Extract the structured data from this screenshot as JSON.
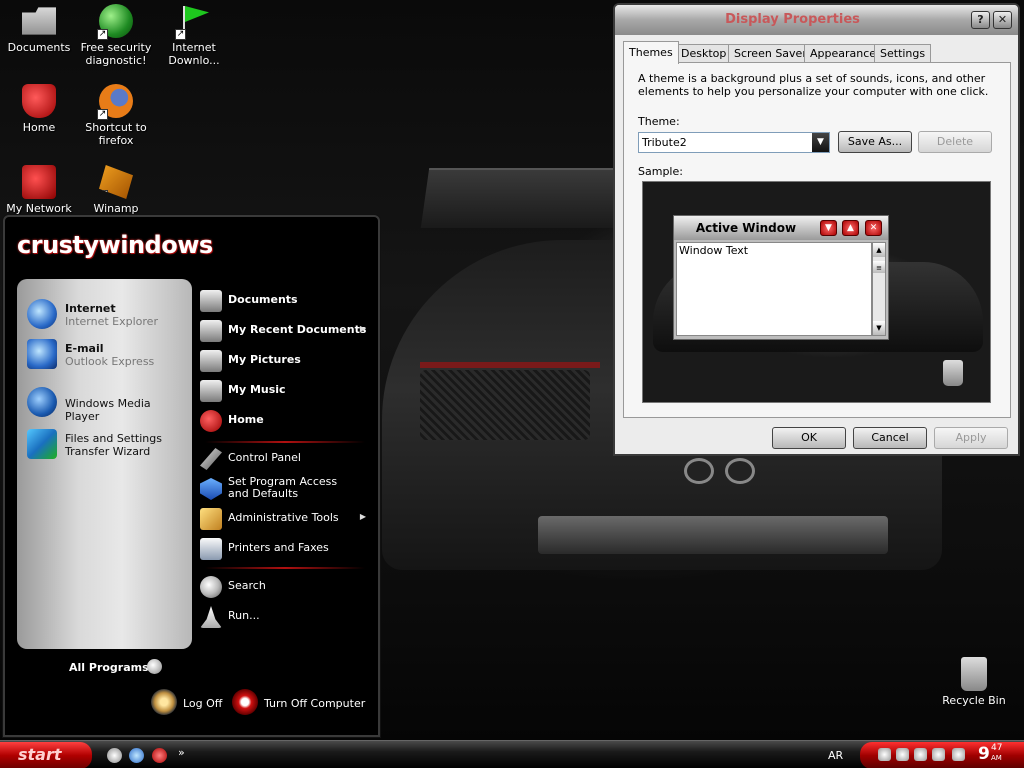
{
  "desktop": {
    "icons": [
      {
        "label": "Documents",
        "icon": "folder-icon"
      },
      {
        "label": "Free security diagnostic!",
        "icon": "globe-icon"
      },
      {
        "label": "Internet Downlo...",
        "icon": "flag-icon"
      },
      {
        "label": "Home",
        "icon": "home-icon"
      },
      {
        "label": "Shortcut to firefox",
        "icon": "firefox-icon"
      },
      {
        "label": "My Network",
        "icon": "network-icon"
      },
      {
        "label": "Winamp",
        "icon": "winamp-icon"
      },
      {
        "label": "Recycle Bin",
        "icon": "recycle-bin-icon"
      }
    ]
  },
  "start_menu": {
    "user_name": "crustywindows",
    "pinned": [
      {
        "title": "Internet",
        "subtitle": "Internet Explorer",
        "icon": "internet-explorer-icon"
      },
      {
        "title": "E-mail",
        "subtitle": "Outlook Express",
        "icon": "email-icon"
      }
    ],
    "recent": [
      {
        "label": "Windows Media Player",
        "icon": "media-player-icon"
      },
      {
        "label": "Files and Settings Transfer Wizard",
        "icon": "transfer-wizard-icon"
      }
    ],
    "right_items": [
      {
        "label": "Documents",
        "icon": "folder-icon"
      },
      {
        "label": "My Recent Documents",
        "icon": "recent-documents-icon",
        "submenu": true
      },
      {
        "label": "My Pictures",
        "icon": "pictures-icon"
      },
      {
        "label": "My Music",
        "icon": "music-icon"
      },
      {
        "label": "Home",
        "icon": "home-icon"
      },
      {
        "label": "Control Panel",
        "icon": "control-panel-icon"
      },
      {
        "label": "Set Program Access and Defaults",
        "icon": "program-access-icon"
      },
      {
        "label": "Administrative Tools",
        "icon": "admin-tools-icon",
        "submenu": true
      },
      {
        "label": "Printers and Faxes",
        "icon": "printer-icon"
      },
      {
        "label": "Search",
        "icon": "search-icon"
      },
      {
        "label": "Run...",
        "icon": "run-icon"
      }
    ],
    "all_programs": "All Programs",
    "log_off": "Log Off",
    "turn_off": "Turn Off Computer"
  },
  "dialog": {
    "title": "Display Properties",
    "help_glyph": "?",
    "close_glyph": "✕",
    "tabs": [
      "Themes",
      "Desktop",
      "Screen Saver",
      "Appearance",
      "Settings"
    ],
    "active_tab": "Themes",
    "description": "A theme is a background plus a set of sounds, icons, and other elements to help you personalize your computer with one click.",
    "theme_label": "Theme:",
    "theme_value": "Tribute2",
    "save_as": "Save As...",
    "delete": "Delete",
    "sample_label": "Sample:",
    "sample_window_title": "Active Window",
    "sample_window_text": "Window Text",
    "ok": "OK",
    "cancel": "Cancel",
    "apply": "Apply"
  },
  "taskbar": {
    "start_label": "start",
    "quicklaunch_more": "»",
    "language": "AR",
    "clock_hour": "9",
    "clock_minute": "47",
    "clock_ampm": "AM"
  },
  "colors": {
    "accent_red": "#b00000",
    "title_text": "#c8585a"
  }
}
